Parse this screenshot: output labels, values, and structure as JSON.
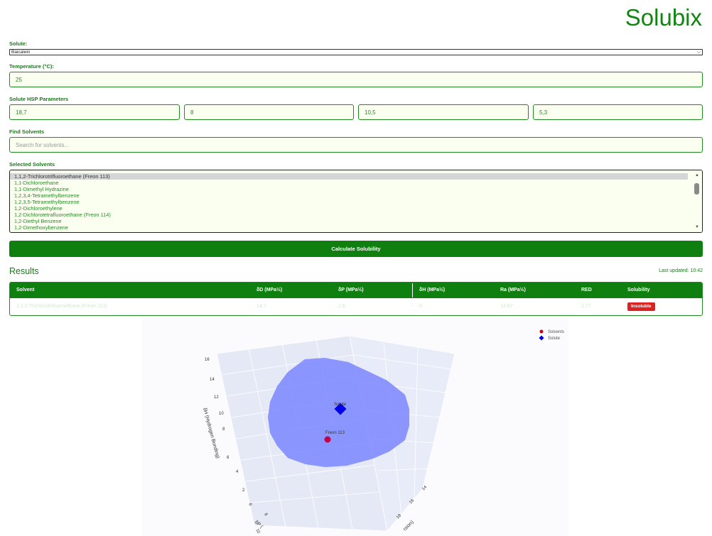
{
  "app": {
    "title": "Solubix"
  },
  "form": {
    "solute_label": "Solute:",
    "solute_value": "Baicalein",
    "temperature_label": "Temperature (°C):",
    "temperature_value": "25",
    "hsp_label": "Solute HSP Parameters",
    "hsp_values": [
      "18,7",
      "8",
      "10,5",
      "5,3"
    ],
    "find_label": "Find Solvents",
    "search_placeholder": "Search for solvents...",
    "selected_label": "Selected Solvents",
    "solvents": [
      "1,1,2-Trichlorotrifluoroethane (Freon 113)",
      "1,1-Dichloroethane",
      "1,1-Dimethyl Hydrazine",
      "1,2,3,4-Tetramethylbenzene",
      "1,2,3,5-Tetramethylbenzene",
      "1,2-Dichloroethylene",
      "1,2-Dichlorotetrafluoroethane (Freon 114)",
      "1,2-Diethyl Benzene",
      "1,2-Dimethoxybenzene"
    ],
    "calculate_label": "Calculate Solubility"
  },
  "results": {
    "title": "Results",
    "last_updated": "Last updated: 10:42",
    "headers": [
      "Solvent",
      "δD (MPa½)",
      "δP (MPa½)",
      "δH (MPa½)",
      "Ra (MPa½)",
      "RED",
      "Solubility"
    ],
    "rows": [
      {
        "solvent": "1,1,2-Trichlorotrifluoroethane (Freon 113)",
        "dD": "14.7",
        "dP": "1.6",
        "dH": "0",
        "Ra": "14.67",
        "RED": "2.77",
        "solubility": "Insoluble"
      }
    ]
  },
  "plot": {
    "legend": [
      "Solvents",
      "Solute"
    ],
    "colors": {
      "solvent": "#cc0000",
      "solute": "#0000ee",
      "sphere": "#7b86ff",
      "badge": "#dd2222",
      "accent": "#0f7f0f"
    },
    "z_ticks": [
      "16",
      "14",
      "12",
      "10",
      "8",
      "6",
      "4",
      "2"
    ],
    "x_ticks": [
      "10",
      "8",
      "6"
    ],
    "y_ticks": [
      "14",
      "16",
      "18"
    ],
    "z_title": "δH (Hydrogen Bonding)",
    "x_title": "δP (",
    "y_title": "rsion)",
    "solute_label": "Solute",
    "solvent_label": "Freon 113"
  }
}
